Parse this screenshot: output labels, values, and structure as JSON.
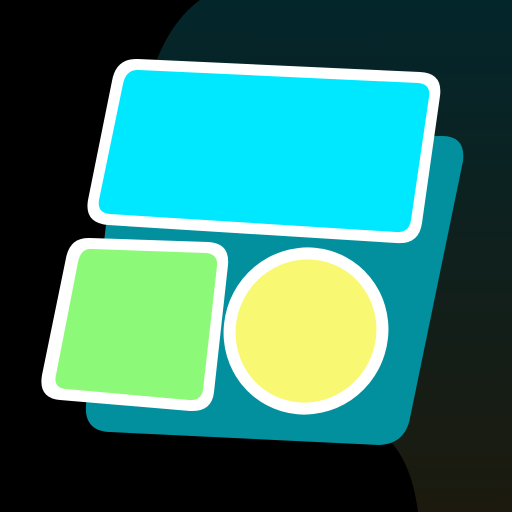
{
  "icon": {
    "name": "layout-widgets-icon",
    "colors": {
      "background": "#000000",
      "backdrop_top": "#03262B",
      "backdrop_bottom": "#1C1A0E",
      "back_panel": "#03909E",
      "outline": "#FFFFFF",
      "top_tile": "#00E8FF",
      "left_tile": "#8CFA78",
      "circle_tile": "#F8F872"
    }
  }
}
